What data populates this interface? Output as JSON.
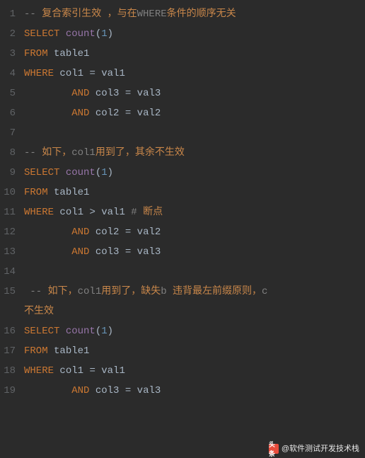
{
  "attribution": {
    "logo_text": "头条",
    "text": "@软件测试开发技术栈"
  },
  "lines": [
    {
      "n": "1",
      "tokens": [
        [
          "comment",
          "-- "
        ],
        [
          "comment-cn",
          "复合索引生效 ，与在"
        ],
        [
          "comment",
          "WHERE"
        ],
        [
          "comment-cn",
          "条件的顺序无关"
        ]
      ]
    },
    {
      "n": "2",
      "tokens": [
        [
          "keyword",
          "SELECT"
        ],
        [
          "ident",
          " "
        ],
        [
          "func",
          "count"
        ],
        [
          "paren",
          "("
        ],
        [
          "num",
          "1"
        ],
        [
          "paren",
          ")"
        ]
      ]
    },
    {
      "n": "3",
      "tokens": [
        [
          "keyword",
          "FROM"
        ],
        [
          "ident",
          " table1"
        ]
      ]
    },
    {
      "n": "4",
      "tokens": [
        [
          "keyword",
          "WHERE"
        ],
        [
          "ident",
          " col1 "
        ],
        [
          "op",
          "="
        ],
        [
          "ident",
          " val1"
        ]
      ]
    },
    {
      "n": "5",
      "tokens": [
        [
          "ident",
          "        "
        ],
        [
          "keyword",
          "AND"
        ],
        [
          "ident",
          " col3 "
        ],
        [
          "op",
          "="
        ],
        [
          "ident",
          " val3"
        ]
      ]
    },
    {
      "n": "6",
      "tokens": [
        [
          "ident",
          "        "
        ],
        [
          "keyword",
          "AND"
        ],
        [
          "ident",
          " col2 "
        ],
        [
          "op",
          "="
        ],
        [
          "ident",
          " val2"
        ]
      ]
    },
    {
      "n": "7",
      "tokens": []
    },
    {
      "n": "8",
      "tokens": [
        [
          "comment",
          "-- "
        ],
        [
          "comment-cn",
          "如下，"
        ],
        [
          "comment",
          "col1"
        ],
        [
          "comment-cn",
          "用到了，其余不生效"
        ]
      ]
    },
    {
      "n": "9",
      "tokens": [
        [
          "keyword",
          "SELECT"
        ],
        [
          "ident",
          " "
        ],
        [
          "func",
          "count"
        ],
        [
          "paren",
          "("
        ],
        [
          "num",
          "1"
        ],
        [
          "paren",
          ")"
        ]
      ]
    },
    {
      "n": "10",
      "tokens": [
        [
          "keyword",
          "FROM"
        ],
        [
          "ident",
          " table1"
        ]
      ]
    },
    {
      "n": "11",
      "tokens": [
        [
          "keyword",
          "WHERE"
        ],
        [
          "ident",
          " col1 "
        ],
        [
          "op",
          ">"
        ],
        [
          "ident",
          " val1 "
        ],
        [
          "hash",
          "# "
        ],
        [
          "comment-cn",
          "断点"
        ]
      ]
    },
    {
      "n": "12",
      "tokens": [
        [
          "ident",
          "        "
        ],
        [
          "keyword",
          "AND"
        ],
        [
          "ident",
          " col2 "
        ],
        [
          "op",
          "="
        ],
        [
          "ident",
          " val2"
        ]
      ]
    },
    {
      "n": "13",
      "tokens": [
        [
          "ident",
          "        "
        ],
        [
          "keyword",
          "AND"
        ],
        [
          "ident",
          " col3 "
        ],
        [
          "op",
          "="
        ],
        [
          "ident",
          " val3"
        ]
      ]
    },
    {
      "n": "14",
      "tokens": []
    },
    {
      "n": "15",
      "tokens": [
        [
          "comment",
          " -- "
        ],
        [
          "comment-cn",
          "如下，"
        ],
        [
          "comment",
          "col1"
        ],
        [
          "comment-cn",
          "用到了，缺失"
        ],
        [
          "comment",
          "b "
        ],
        [
          "comment-cn",
          "违背最左前缀原则，"
        ],
        [
          "comment",
          "c"
        ]
      ]
    },
    {
      "n": "",
      "wrap": true,
      "tokens": [
        [
          "comment-cn",
          "不生效"
        ]
      ]
    },
    {
      "n": "16",
      "tokens": [
        [
          "keyword",
          "SELECT"
        ],
        [
          "ident",
          " "
        ],
        [
          "func",
          "count"
        ],
        [
          "paren",
          "("
        ],
        [
          "num",
          "1"
        ],
        [
          "paren",
          ")"
        ]
      ]
    },
    {
      "n": "17",
      "tokens": [
        [
          "keyword",
          "FROM"
        ],
        [
          "ident",
          " table1"
        ]
      ]
    },
    {
      "n": "18",
      "tokens": [
        [
          "keyword",
          "WHERE"
        ],
        [
          "ident",
          " col1 "
        ],
        [
          "op",
          "="
        ],
        [
          "ident",
          " val1"
        ]
      ]
    },
    {
      "n": "19",
      "tokens": [
        [
          "ident",
          "        "
        ],
        [
          "keyword",
          "AND"
        ],
        [
          "ident",
          " col3 "
        ],
        [
          "op",
          "="
        ],
        [
          "ident",
          " val3"
        ]
      ]
    }
  ]
}
